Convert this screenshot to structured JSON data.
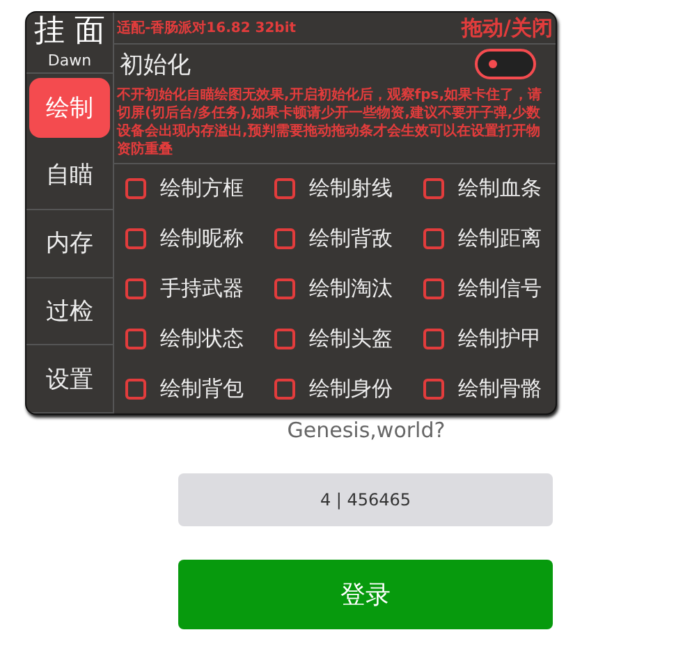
{
  "sidebar": {
    "title": "挂 面",
    "subtitle": "Dawn",
    "items": [
      {
        "label": "绘制",
        "selected": true
      },
      {
        "label": "自瞄",
        "selected": false
      },
      {
        "label": "内存",
        "selected": false
      },
      {
        "label": "过检",
        "selected": false
      },
      {
        "label": "设置",
        "selected": false
      }
    ]
  },
  "header": {
    "version": "适配-香肠派对16.82 32bit",
    "drag_close": "拖动/关闭"
  },
  "init": {
    "label": "初始化",
    "on": false,
    "notice": "不开初始化自瞄绘图无效果,开启初始化后，观察fps,如果卡住了，请切屏(切后台/多任务),如果卡顿请少开一些物资,建议不要开子弹,少数设备会出现内存溢出,预判需要拖动拖动条才会生效可以在设置打开物资防重叠"
  },
  "options": [
    {
      "label": "绘制方框",
      "checked": false
    },
    {
      "label": "绘制射线",
      "checked": false
    },
    {
      "label": "绘制血条",
      "checked": false
    },
    {
      "label": "绘制昵称",
      "checked": false
    },
    {
      "label": "绘制背敌",
      "checked": false
    },
    {
      "label": "绘制距离",
      "checked": false
    },
    {
      "label": "手持武器",
      "checked": false
    },
    {
      "label": "绘制淘汰",
      "checked": false
    },
    {
      "label": "绘制信号",
      "checked": false
    },
    {
      "label": "绘制状态",
      "checked": false
    },
    {
      "label": "绘制头盔",
      "checked": false
    },
    {
      "label": "绘制护甲",
      "checked": false
    },
    {
      "label": "绘制背包",
      "checked": false
    },
    {
      "label": "绘制身份",
      "checked": false
    },
    {
      "label": "绘制骨骼",
      "checked": false
    }
  ],
  "login": {
    "tagline": "Genesis,world?",
    "code": "4 | 456465",
    "button": "登录"
  }
}
